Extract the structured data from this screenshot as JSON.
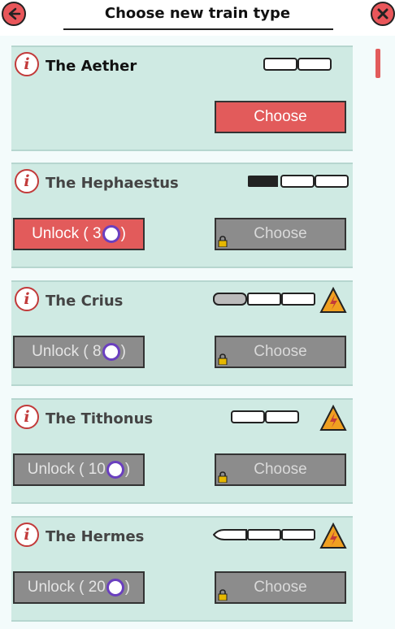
{
  "header": {
    "title": "Choose new train type"
  },
  "colors": {
    "accent": "#e25b5b",
    "card_bg": "#cfeae3",
    "disabled": "#8c8c8c",
    "coin_ring": "#6a3fbf"
  },
  "icons": {
    "back": "back-arrow-icon",
    "close": "close-x-icon",
    "info": "info-icon",
    "warning": "warning-lightning-icon",
    "lock": "lock-icon",
    "coin": "coin-icon"
  },
  "info_glyph": "i",
  "trains": [
    {
      "name": "The Aether",
      "choose_label": "Choose",
      "choose_enabled": true,
      "unlock": null,
      "warning": false
    },
    {
      "name": "The Hephaestus",
      "choose_label": "Choose",
      "choose_enabled": false,
      "unlock": {
        "prefix": "Unlock ( 3",
        "suffix": ")",
        "enabled": true
      },
      "warning": false
    },
    {
      "name": "The Crius",
      "choose_label": "Choose",
      "choose_enabled": false,
      "unlock": {
        "prefix": "Unlock ( 8",
        "suffix": ")",
        "enabled": false
      },
      "warning": true
    },
    {
      "name": "The Tithonus",
      "choose_label": "Choose",
      "choose_enabled": false,
      "unlock": {
        "prefix": "Unlock ( 10",
        "suffix": ")",
        "enabled": false
      },
      "warning": true
    },
    {
      "name": "The Hermes",
      "choose_label": "Choose",
      "choose_enabled": false,
      "unlock": {
        "prefix": "Unlock ( 20",
        "suffix": ")",
        "enabled": false
      },
      "warning": true
    }
  ]
}
